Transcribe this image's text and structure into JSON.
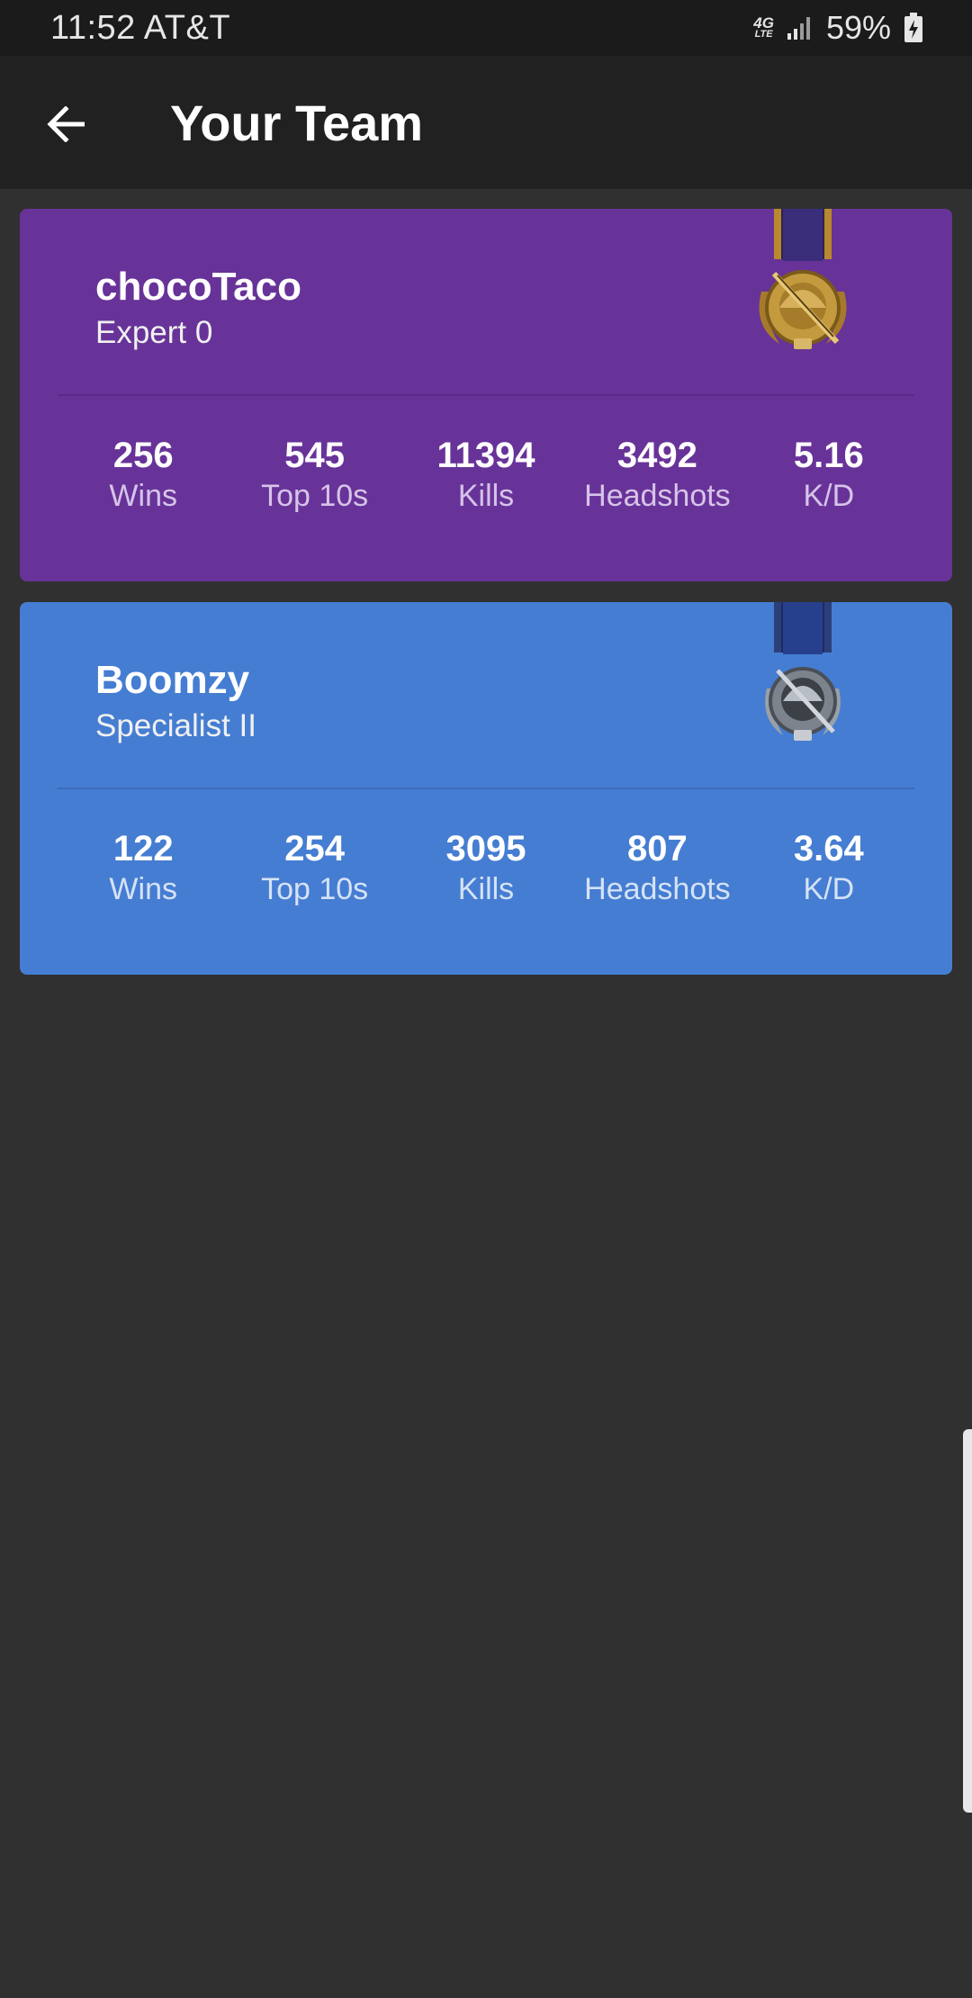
{
  "status_bar": {
    "time_carrier": "11:52 AT&T",
    "network_line1": "4G",
    "network_line2": "LTE",
    "battery": "59%"
  },
  "app_bar": {
    "title": "Your Team",
    "back_icon": "arrow-left-icon"
  },
  "team": [
    {
      "name": "chocoTaco",
      "rank": "Expert 0",
      "medal": "gold-medal-icon",
      "color": "#683399",
      "stats": [
        {
          "value": "256",
          "label": "Wins"
        },
        {
          "value": "545",
          "label": "Top 10s"
        },
        {
          "value": "11394",
          "label": "Kills"
        },
        {
          "value": "3492",
          "label": "Headshots"
        },
        {
          "value": "5.16",
          "label": "K/D"
        }
      ]
    },
    {
      "name": "Boomzy",
      "rank": "Specialist II",
      "medal": "silver-medal-icon",
      "color": "#457dd2",
      "stats": [
        {
          "value": "122",
          "label": "Wins"
        },
        {
          "value": "254",
          "label": "Top 10s"
        },
        {
          "value": "3095",
          "label": "Kills"
        },
        {
          "value": "807",
          "label": "Headshots"
        },
        {
          "value": "3.64",
          "label": "K/D"
        }
      ]
    }
  ]
}
